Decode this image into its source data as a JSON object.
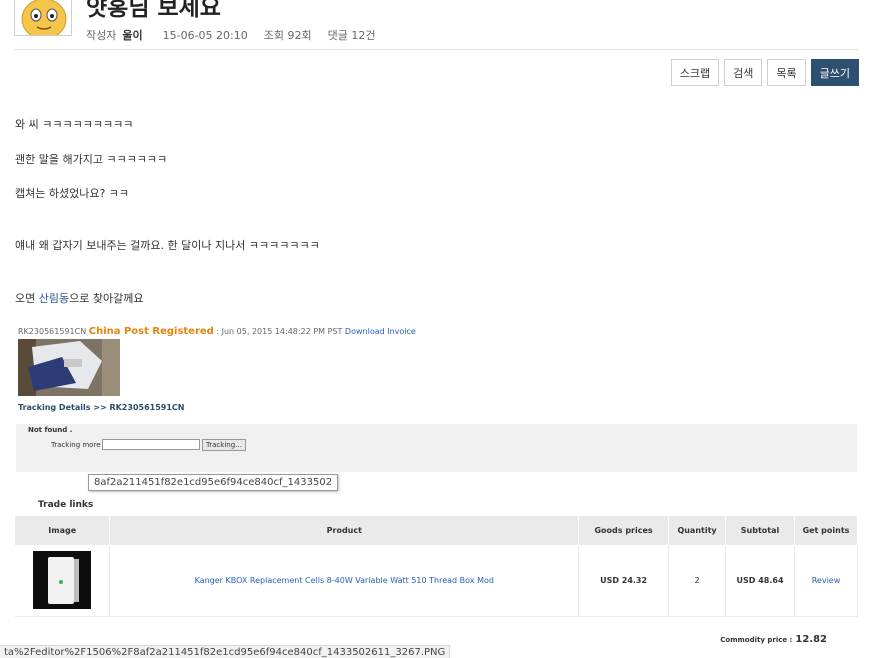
{
  "post": {
    "title": "얏홍님 보세요",
    "author_label": "작성자",
    "author": "울이",
    "date": "15-06-05 20:10",
    "views": "조회 92회",
    "comments": "댓글 12건"
  },
  "toolbar": {
    "scrap": "스크랩",
    "search": "검색",
    "list": "목록",
    "write": "글쓰기"
  },
  "body": {
    "line1": "와 씨 ㅋㅋㅋㅋㅋㅋㅋㅋㅋ",
    "line2": "괜한 말을 해가지고 ㅋㅋㅋㅋㅋㅋ",
    "line3": "캡쳐는 하셨었나요? ㅋㅋ",
    "line4": "얘내 왜 갑자기 보내주는 걸까요. 한 달이나 지나서 ㅋㅋㅋㅋㅋㅋㅋ",
    "line5_pre": "오면 ",
    "line5_link": "산림동",
    "line5_post": "으로 찾아갈께요"
  },
  "tracking": {
    "number": "RK230561591CN",
    "carrier": "China Post Registered",
    "date": ": Jun 05, 2015 14:48:22 PM PST",
    "download": "Download Invoice",
    "details": "Tracking Details >> RK230561591CN",
    "not_found": "Not found .",
    "more_label": "Tracking more :",
    "more_button": "Tracking..."
  },
  "tooltip": "8af2a211451f82e1cd95e6f94ce840cf_1433502",
  "trade": {
    "title": "Trade links",
    "headers": [
      "Image",
      "Product",
      "Goods prices",
      "Quantity",
      "Subtotal",
      "Get points"
    ],
    "row": {
      "product": "Kanger KBOX Replacement Cells 8-40W Variable Watt 510 Thread Box Mod",
      "price": "USD 24.32",
      "quantity": "2",
      "subtotal": "USD 48.64",
      "points": "Review"
    },
    "commodity_label": "Commodity price :",
    "commodity_value": "12.82"
  },
  "status_url": "ta%2Feditor%2F1506%2F8af2a211451f82e1cd95e6f94ce840cf_1433502611_3267.PNG",
  "colors": {
    "accent": "#2d4f70",
    "carrier": "#e8830c",
    "link": "#2a60b8"
  }
}
